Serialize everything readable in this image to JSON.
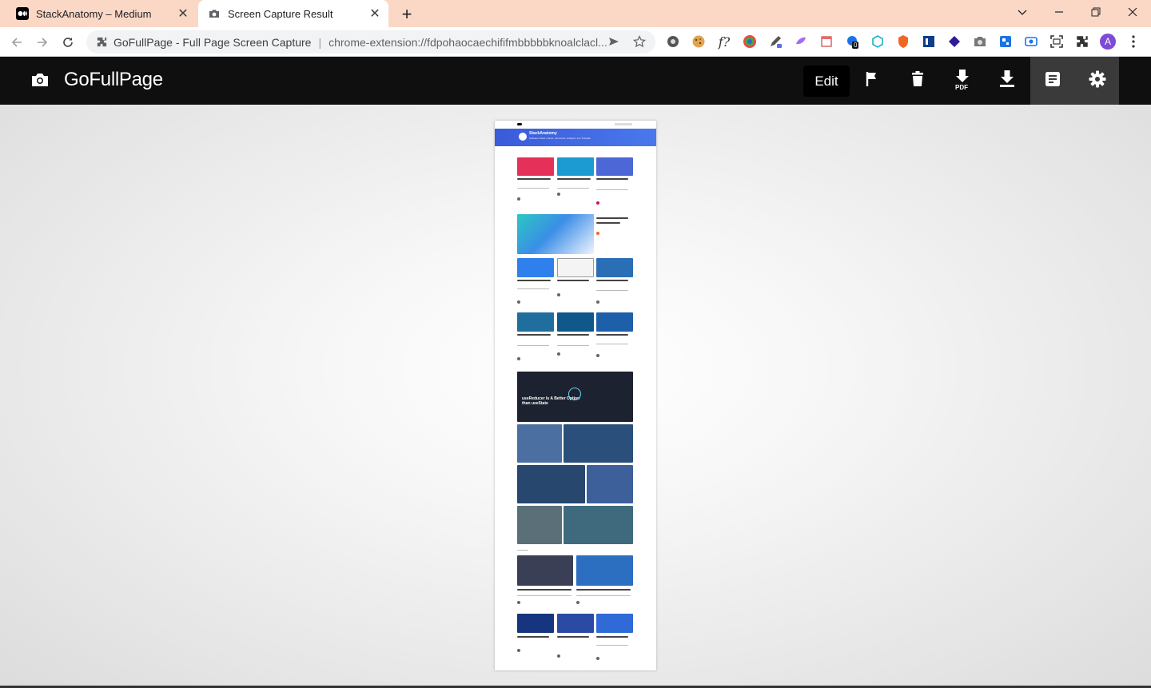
{
  "browser": {
    "tabs": [
      {
        "title": "StackAnatomy – Medium",
        "icon": "medium-icon",
        "active": false
      },
      {
        "title": "Screen Capture Result",
        "icon": "camera-icon",
        "active": true
      }
    ],
    "omnibox": {
      "site": "GoFullPage - Full Page Screen Capture",
      "separator": "|",
      "url": "chrome-extension://fdpohaocaechififmbbbbbknoalclacl..."
    },
    "extensions": [
      "settings-gear-icon",
      "cookie-icon",
      "fx-icon",
      "color-picker-icon",
      "paint-icon",
      "pen-icon",
      "notes-icon",
      "badge-counter-icon",
      "cube-icon",
      "shield-icon",
      "book-icon",
      "diamond-icon",
      "camera-icon",
      "grid-icon",
      "record-icon",
      "screenshot-icon",
      "puzzle-icon"
    ],
    "badge_count": "0",
    "avatar_letter": "A"
  },
  "app": {
    "title": "GoFullPage",
    "edit_label": "Edit",
    "pdf_label": "PDF"
  },
  "preview": {
    "banner_title": "StackAnatomy",
    "banner_subtitle": "Software Stack | News, Interviews, Analysis, and Tutorials",
    "featured_title": "useReducer Is A Better Option than useState"
  },
  "colors": {
    "tab_strip": "#fbd8c6",
    "app_header": "#0f0f0f",
    "banner": "#3a5bd9"
  }
}
